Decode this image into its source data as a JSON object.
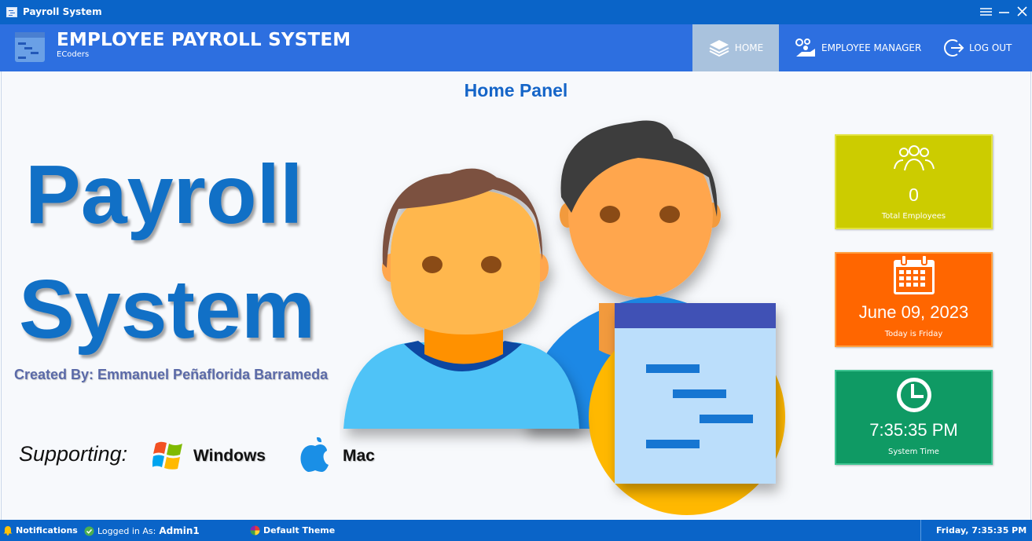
{
  "window": {
    "title": "Payroll System",
    "icons": {
      "app": "app-window-icon",
      "menu": "hamburger-menu-icon",
      "minimize": "minimize-icon",
      "close": "close-icon"
    }
  },
  "header": {
    "app_name": "EMPLOYEE PAYROLL SYSTEM",
    "subtitle": "ECoders",
    "nav": [
      {
        "label": "HOME",
        "icon": "layers-icon",
        "active": true
      },
      {
        "label": "EMPLOYEE MANAGER",
        "icon": "employee-manager-icon",
        "active": false
      },
      {
        "label": "LOG OUT",
        "icon": "logout-icon",
        "active": false
      }
    ]
  },
  "main": {
    "panel_title": "Home Panel",
    "hero_line1": "Payroll",
    "hero_line2": "System",
    "credit": "Created By: Emmanuel Peñaflorida Barrameda",
    "supporting_label": "Supporting:",
    "platforms": [
      {
        "label": "Windows",
        "icon": "windows-logo-icon"
      },
      {
        "label": "Mac",
        "icon": "apple-logo-icon"
      }
    ]
  },
  "cards": [
    {
      "value": "0",
      "caption": "Total Employees",
      "icon": "group-users-icon",
      "color": "#cccc00"
    },
    {
      "value": "June 09, 2023",
      "caption": "Today is Friday",
      "icon": "calendar-icon",
      "color": "#ff6600"
    },
    {
      "value": "7:35:35 PM",
      "caption": "System Time",
      "icon": "clock-icon",
      "color": "#0f9a64"
    }
  ],
  "statusbar": {
    "notifications": "Notifications",
    "logged_in_prefix": "Logged in As:",
    "user": "Admin1",
    "theme": "Default Theme",
    "datetime": "Friday, 7:35:35 PM"
  },
  "colors": {
    "titlebar": "#0a64c8",
    "header": "#2d6fe0",
    "nav_active": "#a9c2dd",
    "hero_text": "#1170c6"
  }
}
